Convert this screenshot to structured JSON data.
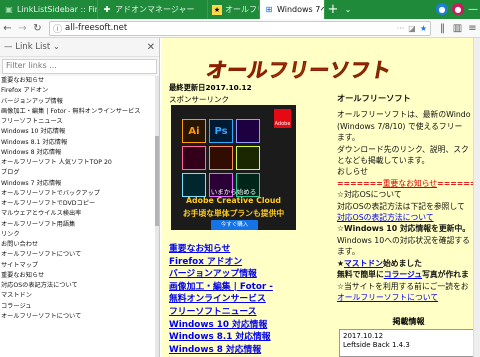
{
  "tabs": [
    {
      "label": "LinkListSidebar :: Firefox 向けア",
      "icon": "puzzle-icon"
    },
    {
      "label": "アドオンマネージャー",
      "icon": "puzzle-icon"
    },
    {
      "label": "オールフリーソフト",
      "icon": "site-icon"
    },
    {
      "label": "Windows 7ペ",
      "icon": "windows-icon",
      "active": true
    }
  ],
  "navbar": {
    "url": "all-freesoft.net"
  },
  "sidebar": {
    "title": "Link List",
    "filter_placeholder": "Filter links ...",
    "items": [
      "重要なお知らせ",
      "Firefox アドオン",
      "バージョンアップ情報",
      "画像加工・編集 | Fotor - 無料オンラインサービス",
      "フリーソフトニュース",
      "Windows 10 対応情報",
      "Windows 8.1 対応情報",
      "Windows 8 対応情報",
      "オールフリーソフト 人気ソフトTOP 20",
      "ブログ",
      "Windows 7 対応情報",
      "オールフリーソフトでバックアップ",
      "オールフリーソフトでDVDコピー",
      "マルウェアとウイルス検出率",
      "オールフリーソフト用語集",
      "リンク",
      "お問い合わせ",
      "オールフリーソフトについて",
      "サイトマップ",
      "重要なお知らせ",
      "対応OSの表記方法について",
      "マストドン",
      "コラージュ",
      "オールフリーソフトについて"
    ]
  },
  "content": {
    "logo_text": "オールフリーソフト",
    "updated": "最終更新日2017.10.12",
    "sponsor": "スポンサーリンク",
    "ad": {
      "tiles": [
        "Ai",
        "Ps",
        "",
        "",
        "",
        "",
        "",
        "",
        ""
      ],
      "line1": "いまから始める",
      "line2": "Adobe Creative Cloud",
      "line3": "お手頃な単体プランも提供中",
      "button": "今すぐ購入",
      "brand": "Adobe"
    },
    "links": [
      "重要なお知らせ",
      "Firefox アドオン",
      "バージョンアップ情報",
      "画像加工・編集 | Fotor -",
      "無料オンラインサービス",
      "フリーソフトニュース",
      "Windows 10 対応情報",
      "Windows 8.1 対応情報",
      "Windows 8 対応情報"
    ],
    "right": {
      "heading": "オールフリーソフト",
      "intro": [
        "オールフリーソフトは、最新のWindo",
        "(Windows 7/8/10) で使えるフリー",
        "ます。",
        "ダウンロード先のリンク、説明、スク",
        "となども掲載しています。",
        "おしらせ"
      ],
      "notice_prefix": "=======",
      "notice_link": "重要なお知らせ",
      "notice_suffix": "======",
      "os_lines": [
        "☆対応OSについて",
        "対応OSの表記方法は下記を参照して",
        "対応OSの表記方法について"
      ],
      "win10_line": "☆Windows 10 対応情報を更新中。",
      "win10_sub": "Windows 10への対応状況を確認する",
      "win10_sub2": "ます。",
      "mastodon_pre": "★",
      "mastodon_link": "マストドン",
      "mastodon_post": "始めました",
      "collage_pre": "無料で簡単に",
      "collage_link": "コラージュ",
      "collage_post": "写真が作れま",
      "star_line": "☆当サイトを利用する前にご一読をお",
      "about_link": "オールフリーソフトについて"
    },
    "pub_heading": "掲載情報",
    "pub_date": "2017.10.12",
    "pub_item": "Leftside Back 1.4.3"
  }
}
